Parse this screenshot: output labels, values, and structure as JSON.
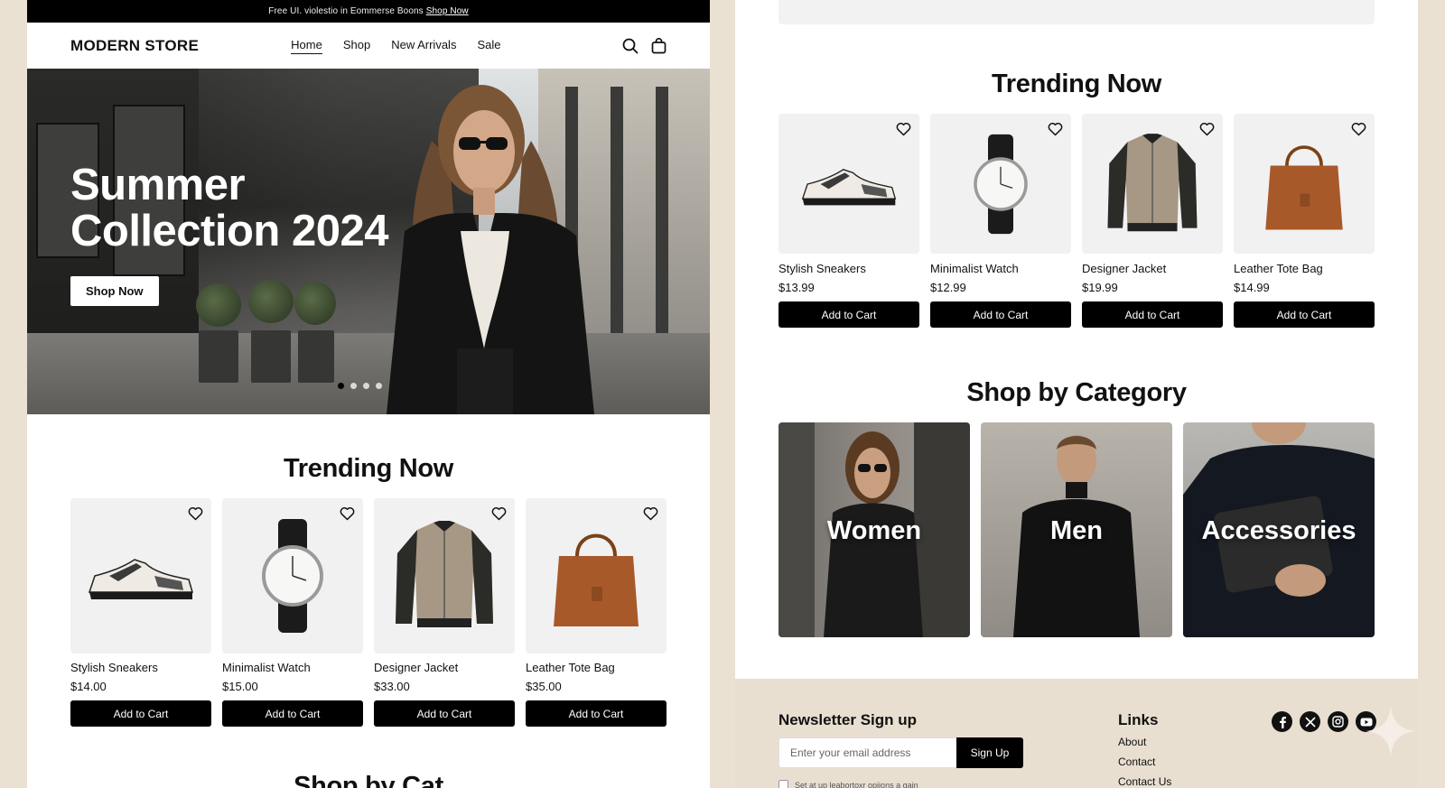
{
  "left": {
    "promo": {
      "text": "Free UI. violestio in Eommerse Boons",
      "link": "Shop Now"
    },
    "header": {
      "logo": "MODERN STORE",
      "nav": [
        "Home",
        "Shop",
        "New Arrivals",
        "Sale"
      ],
      "active_nav": "Home",
      "icons": [
        "search-icon",
        "shopping-bag-icon"
      ]
    },
    "hero": {
      "title_line1": "Summer",
      "title_line2": "Collection 2024",
      "button": "Shop Now",
      "slides": 4,
      "active_slide": 1
    },
    "trending": {
      "title": "Trending Now",
      "products": [
        {
          "name": "Stylish Sneakers",
          "price": "$14.00",
          "button": "Add to Cart",
          "icon": "sneaker-image"
        },
        {
          "name": "Minimalist Watch",
          "price": "$15.00",
          "button": "Add to Cart",
          "icon": "watch-image"
        },
        {
          "name": "Designer Jacket",
          "price": "$33.00",
          "button": "Add to Cart",
          "icon": "jacket-image"
        },
        {
          "name": "Leather Tote Bag",
          "price": "$35.00",
          "button": "Add to Cart",
          "icon": "tote-bag-image"
        }
      ]
    },
    "next_section_title": "Shop by Cat"
  },
  "right": {
    "trending": {
      "title": "Trending Now",
      "products": [
        {
          "name": "Stylish Sneakers",
          "price": "$13.99",
          "button": "Add to Cart",
          "icon": "sneaker-image"
        },
        {
          "name": "Minimalist Watch",
          "price": "$12.99",
          "button": "Add to Cart",
          "icon": "watch-image"
        },
        {
          "name": "Designer Jacket",
          "price": "$19.99",
          "button": "Add to Cart",
          "icon": "jacket-image"
        },
        {
          "name": "Leather Tote Bag",
          "price": "$14.99",
          "button": "Add to Cart",
          "icon": "tote-bag-image"
        }
      ]
    },
    "categories": {
      "title": "Shop by Category",
      "items": [
        "Women",
        "Men",
        "Accessories"
      ]
    },
    "footer": {
      "newsletter_title": "Newsletter Sign up",
      "email_placeholder": "Enter your email address",
      "signup_button": "Sign Up",
      "checkbox_label": "Set at up leabortoxr opiions a gain",
      "links_title": "Links",
      "links": [
        "About",
        "Contact",
        "Contact Us"
      ],
      "social_icons": [
        "facebook-icon",
        "x-twitter-icon",
        "instagram-icon",
        "youtube-icon"
      ]
    }
  },
  "colors": {
    "page_background": "#ebe1d3",
    "footer_background": "#e8dfd1",
    "primary": "#000000",
    "card_background": "#f1f1f1"
  }
}
